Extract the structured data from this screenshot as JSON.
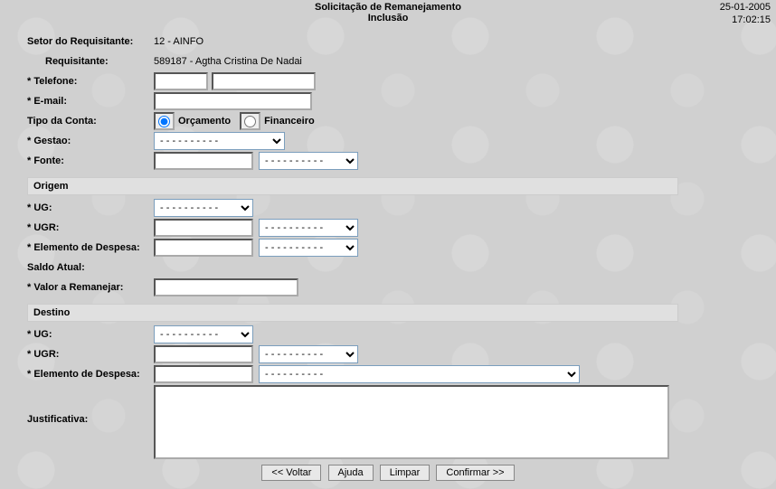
{
  "header": {
    "title": "Solicitação de Remanejamento",
    "subtitle": "Inclusão",
    "date": "25-01-2005",
    "time": "17:02:15"
  },
  "labels": {
    "setor": "Setor do Requisitante:",
    "requisitante": "Requisitante:",
    "telefone": "* Telefone:",
    "email": "* E-mail:",
    "tipo_conta": "Tipo da Conta:",
    "gestao": "* Gestao:",
    "fonte": "* Fonte:",
    "ug": "* UG:",
    "ugr": "* UGR:",
    "elemento": "* Elemento de Despesa:",
    "saldo": "Saldo Atual:",
    "valor": "* Valor a Remanejar:",
    "justificativa": "Justificativa:"
  },
  "values": {
    "setor": "12 - AINFO",
    "requisitante": "589187 - Agtha Cristina De Nadai",
    "tipo_orcamento": "Orçamento",
    "tipo_financeiro": "Financeiro",
    "select_placeholder": "- - - - - - - - - -"
  },
  "sections": {
    "origem": "Origem",
    "destino": "Destino"
  },
  "buttons": {
    "voltar": "<< Voltar",
    "ajuda": "Ajuda",
    "limpar": "Limpar",
    "confirmar": "Confirmar >>"
  }
}
